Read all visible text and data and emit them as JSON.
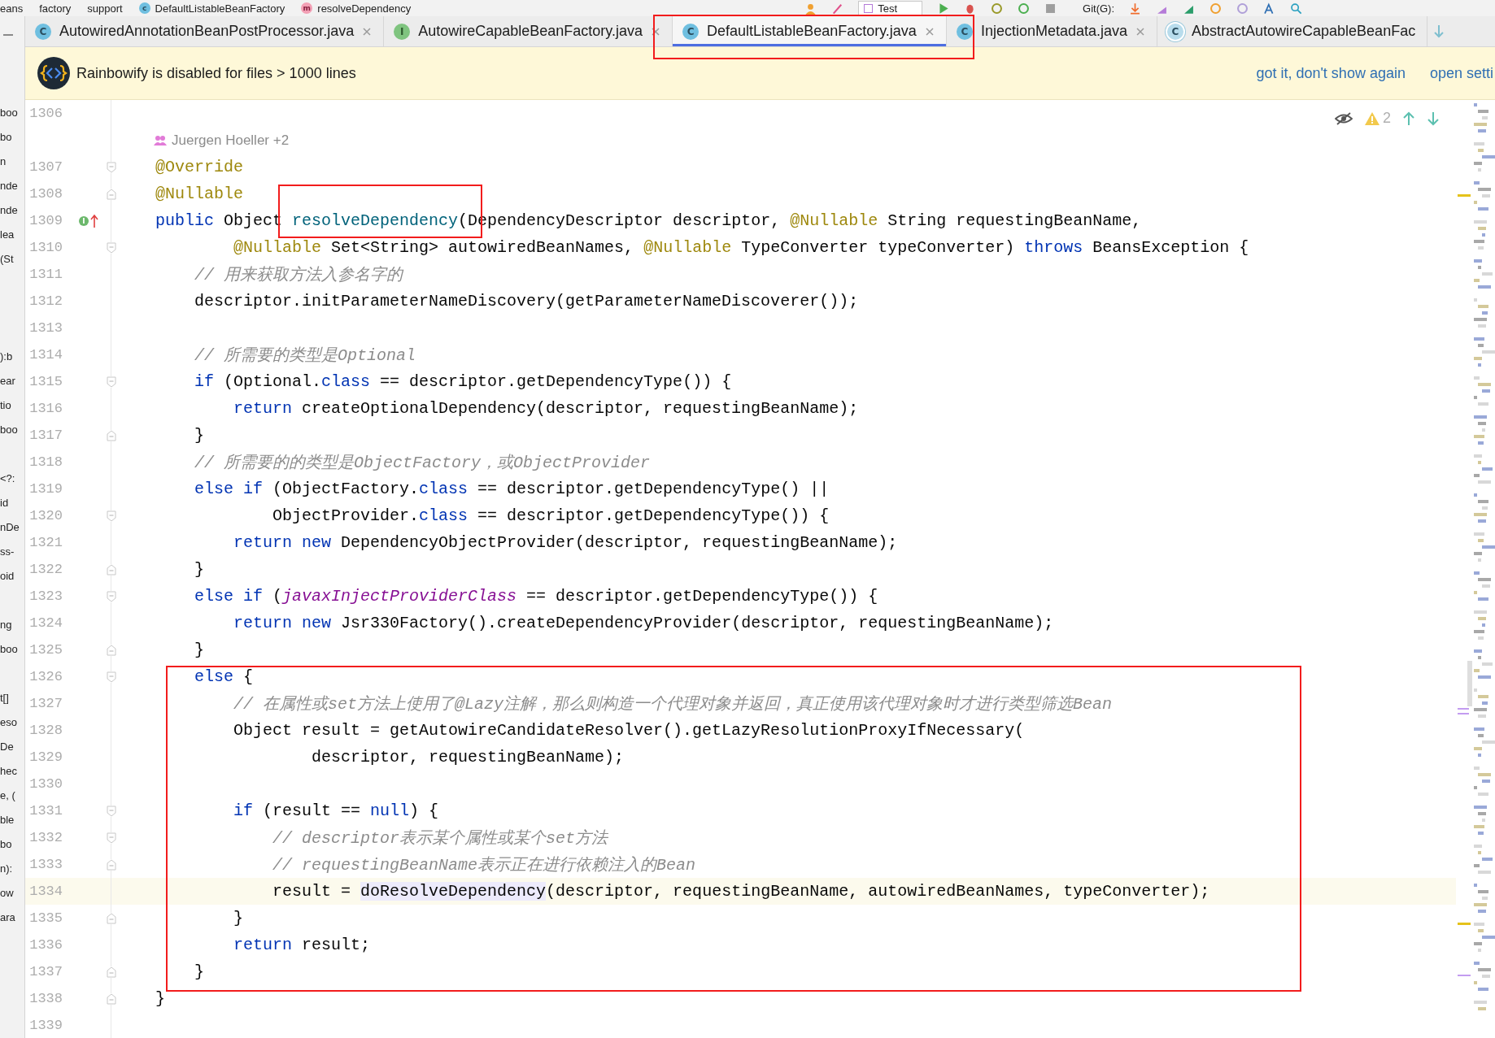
{
  "breadcrumbs": [
    {
      "text": "eans"
    },
    {
      "text": "factory"
    },
    {
      "text": "support"
    },
    {
      "text": "DefaultListableBeanFactory",
      "icon_letter": "c",
      "kind": "class"
    },
    {
      "text": "resolveDependency",
      "icon_letter": "m",
      "kind": "method"
    }
  ],
  "toolbar": {
    "run_config": "Test",
    "vcs_label": "Git(G):"
  },
  "tabs": [
    {
      "label": "AutowiredAnnotationBeanPostProcessor.java",
      "icon_letter": "C",
      "kind": "class",
      "selected": false,
      "boxed": false,
      "closable": true
    },
    {
      "label": "AutowireCapableBeanFactory.java",
      "icon_letter": "I",
      "kind": "interface",
      "selected": false,
      "boxed": false,
      "closable": true
    },
    {
      "label": "DefaultListableBeanFactory.java",
      "icon_letter": "C",
      "kind": "class",
      "selected": true,
      "boxed": true,
      "closable": true
    },
    {
      "label": "InjectionMetadata.java",
      "icon_letter": "C",
      "kind": "class",
      "selected": false,
      "boxed": false,
      "closable": true
    },
    {
      "label": "AbstractAutowireCapableBeanFac",
      "icon_letter": "C",
      "kind": "abstract",
      "selected": false,
      "boxed": false,
      "closable": false
    }
  ],
  "notification": {
    "message": "Rainbowify is disabled for files > 1000 lines",
    "actions": [
      "got it, don't show again",
      "open setti"
    ]
  },
  "project_fragments": [
    [
      "boo",
      "bo",
      "n",
      "nde",
      "nde",
      "lea",
      "(St"
    ],
    [
      "):b",
      "ear",
      "tio",
      "boo"
    ],
    [
      "<?:",
      "id",
      "nDe",
      "ss-",
      "oid"
    ],
    [
      "ng",
      "boo"
    ],
    [
      "t[]",
      "eso",
      "De",
      "hec",
      "e, (",
      "ble",
      "bo",
      "n):",
      "ow",
      "ara"
    ]
  ],
  "inspections": {
    "warnings": "2"
  },
  "code_sections": [
    {
      "boxed": false,
      "lines": [
        {
          "kind": "code",
          "number": "1306",
          "fold_start": false,
          "fold_end": false,
          "current": false
        },
        {
          "kind": "inlay",
          "text": "Juergen Hoeller +2"
        },
        {
          "kind": "code",
          "number": "1307",
          "fold_start": true,
          "fold_end": false,
          "current": false,
          "segments": [
            {
              "kind": "ann",
              "t": "@Override"
            }
          ]
        },
        {
          "kind": "code",
          "number": "1308",
          "fold_start": false,
          "fold_end": true,
          "current": false,
          "segments": [
            {
              "kind": "ann",
              "t": "@Nullable"
            }
          ]
        },
        {
          "kind": "code",
          "number": "1309",
          "fold_start": false,
          "fold_end": false,
          "current": false,
          "gutter_mark": "I",
          "segments": [
            {
              "kind": "kw",
              "t": "public"
            },
            {
              "kind": "plain",
              "t": " Object "
            },
            {
              "kind": "decl",
              "t": "resolveDependency",
              "boxed": true
            },
            {
              "kind": "plain",
              "t": "(DependencyDescriptor descriptor, "
            },
            {
              "kind": "ann",
              "t": "@Nullable"
            },
            {
              "kind": "plain",
              "t": " String requestingBeanName,"
            }
          ]
        },
        {
          "kind": "code",
          "number": "1310",
          "fold_start": true,
          "fold_end": false,
          "current": false,
          "segments": [
            {
              "kind": "ann",
              "t": "        @Nullable"
            },
            {
              "kind": "plain",
              "t": " Set<String> autowiredBeanNames, "
            },
            {
              "kind": "ann",
              "t": "@Nullable"
            },
            {
              "kind": "plain",
              "t": " TypeConverter typeConverter) "
            },
            {
              "kind": "kw",
              "t": "throws"
            },
            {
              "kind": "plain",
              "t": " BeansException {"
            }
          ]
        },
        {
          "kind": "code",
          "number": "1311",
          "fold_start": false,
          "fold_end": false,
          "current": false,
          "segments": [
            {
              "kind": "cmt",
              "t": "    // 用来获取方法入参名字的"
            }
          ]
        },
        {
          "kind": "code",
          "number": "1312",
          "fold_start": false,
          "fold_end": false,
          "current": false,
          "segments": [
            {
              "kind": "plain",
              "t": "    descriptor.initParameterNameDiscovery(getParameterNameDiscoverer());"
            }
          ]
        },
        {
          "kind": "code",
          "number": "1313",
          "fold_start": false,
          "fold_end": false,
          "current": false
        },
        {
          "kind": "code",
          "number": "1314",
          "fold_start": false,
          "fold_end": false,
          "current": false,
          "segments": [
            {
              "kind": "cmt",
              "t": "    // 所需要的类型是Optional"
            }
          ]
        },
        {
          "kind": "code",
          "number": "1315",
          "fold_start": true,
          "fold_end": false,
          "current": false,
          "segments": [
            {
              "kind": "kw",
              "t": "    if"
            },
            {
              "kind": "plain",
              "t": " (Optional."
            },
            {
              "kind": "kw",
              "t": "class"
            },
            {
              "kind": "plain",
              "t": " == descriptor.getDependencyType()) {"
            }
          ]
        },
        {
          "kind": "code",
          "number": "1316",
          "fold_start": false,
          "fold_end": false,
          "current": false,
          "segments": [
            {
              "kind": "kw",
              "t": "        return"
            },
            {
              "kind": "plain",
              "t": " createOptionalDependency(descriptor, requestingBeanName);"
            }
          ]
        },
        {
          "kind": "code",
          "number": "1317",
          "fold_start": false,
          "fold_end": true,
          "current": false,
          "segments": [
            {
              "kind": "plain",
              "t": "    }"
            }
          ]
        },
        {
          "kind": "code",
          "number": "1318",
          "fold_start": false,
          "fold_end": false,
          "current": false,
          "segments": [
            {
              "kind": "cmt",
              "t": "    // 所需要的的类型是ObjectFactory，或ObjectProvider"
            }
          ]
        },
        {
          "kind": "code",
          "number": "1319",
          "fold_start": false,
          "fold_end": false,
          "current": false,
          "segments": [
            {
              "kind": "kw",
              "t": "    else if"
            },
            {
              "kind": "plain",
              "t": " (ObjectFactory."
            },
            {
              "kind": "kw",
              "t": "class"
            },
            {
              "kind": "plain",
              "t": " == descriptor.getDependencyType() ||"
            }
          ]
        },
        {
          "kind": "code",
          "number": "1320",
          "fold_start": true,
          "fold_end": false,
          "current": false,
          "segments": [
            {
              "kind": "plain",
              "t": "            ObjectProvider."
            },
            {
              "kind": "kw",
              "t": "class"
            },
            {
              "kind": "plain",
              "t": " == descriptor.getDependencyType()) {"
            }
          ]
        },
        {
          "kind": "code",
          "number": "1321",
          "fold_start": false,
          "fold_end": false,
          "current": false,
          "segments": [
            {
              "kind": "kw",
              "t": "        return new"
            },
            {
              "kind": "plain",
              "t": " DependencyObjectProvider(descriptor, requestingBeanName);"
            }
          ]
        },
        {
          "kind": "code",
          "number": "1322",
          "fold_start": false,
          "fold_end": true,
          "current": false,
          "segments": [
            {
              "kind": "plain",
              "t": "    }"
            }
          ]
        },
        {
          "kind": "code",
          "number": "1323",
          "fold_start": true,
          "fold_end": false,
          "current": false,
          "segments": [
            {
              "kind": "kw",
              "t": "    else if"
            },
            {
              "kind": "plain",
              "t": " ("
            },
            {
              "kind": "field",
              "t": "javaxInjectProviderClass"
            },
            {
              "kind": "plain",
              "t": " == descriptor.getDependencyType()) {"
            }
          ]
        },
        {
          "kind": "code",
          "number": "1324",
          "fold_start": false,
          "fold_end": false,
          "current": false,
          "segments": [
            {
              "kind": "kw",
              "t": "        return new"
            },
            {
              "kind": "plain",
              "t": " Jsr330Factory().createDependencyProvider(descriptor, requestingBeanName);"
            }
          ]
        },
        {
          "kind": "code",
          "number": "1325",
          "fold_start": false,
          "fold_end": true,
          "current": false,
          "segments": [
            {
              "kind": "plain",
              "t": "    }"
            }
          ]
        }
      ]
    },
    {
      "boxed": true,
      "lines": [
        {
          "kind": "code",
          "number": "1326",
          "fold_start": true,
          "fold_end": false,
          "current": false,
          "segments": [
            {
              "kind": "kw",
              "t": "    else"
            },
            {
              "kind": "plain",
              "t": " {"
            }
          ]
        },
        {
          "kind": "code",
          "number": "1327",
          "fold_start": false,
          "fold_end": false,
          "current": false,
          "segments": [
            {
              "kind": "cmt",
              "t": "        // 在属性或set方法上使用了@Lazy注解，那么则构造一个代理对象并返回，真正使用该代理对象时才进行类型筛选Bean"
            }
          ]
        },
        {
          "kind": "code",
          "number": "1328",
          "fold_start": false,
          "fold_end": false,
          "current": false,
          "segments": [
            {
              "kind": "plain",
              "t": "        Object result = getAutowireCandidateResolver().getLazyResolutionProxyIfNecessary("
            }
          ]
        },
        {
          "kind": "code",
          "number": "1329",
          "fold_start": false,
          "fold_end": false,
          "current": false,
          "segments": [
            {
              "kind": "plain",
              "t": "                descriptor, requestingBeanName);"
            }
          ]
        },
        {
          "kind": "code",
          "number": "1330",
          "fold_start": false,
          "fold_end": false,
          "current": false
        },
        {
          "kind": "code",
          "number": "1331",
          "fold_start": true,
          "fold_end": false,
          "current": false,
          "segments": [
            {
              "kind": "kw",
              "t": "        if"
            },
            {
              "kind": "plain",
              "t": " (result == "
            },
            {
              "kind": "kw",
              "t": "null"
            },
            {
              "kind": "plain",
              "t": ") {"
            }
          ]
        },
        {
          "kind": "code",
          "number": "1332",
          "fold_start": true,
          "fold_end": false,
          "current": false,
          "segments": [
            {
              "kind": "cmt",
              "t": "            // descriptor表示某个属性或某个set方法"
            }
          ]
        },
        {
          "kind": "code",
          "number": "1333",
          "fold_start": false,
          "fold_end": true,
          "current": false,
          "segments": [
            {
              "kind": "cmt",
              "t": "            // requestingBeanName表示正在进行依赖注入的Bean"
            }
          ]
        },
        {
          "kind": "code",
          "number": "1334",
          "fold_start": false,
          "fold_end": false,
          "current": true,
          "segments": [
            {
              "kind": "plain",
              "t": "            result = "
            },
            {
              "kind": "usage",
              "t": "doResolveDependency"
            },
            {
              "kind": "plain",
              "t": "(descriptor, requestingBeanName, autowiredBeanNames, typeConverter);"
            }
          ]
        },
        {
          "kind": "code",
          "number": "1335",
          "fold_start": false,
          "fold_end": true,
          "current": false,
          "segments": [
            {
              "kind": "plain",
              "t": "        }"
            }
          ]
        },
        {
          "kind": "code",
          "number": "1336",
          "fold_start": false,
          "fold_end": false,
          "current": false,
          "segments": [
            {
              "kind": "kw",
              "t": "        return"
            },
            {
              "kind": "plain",
              "t": " result;"
            }
          ]
        },
        {
          "kind": "code",
          "number": "1337",
          "fold_start": false,
          "fold_end": true,
          "current": false,
          "segments": [
            {
              "kind": "plain",
              "t": "    }"
            }
          ]
        }
      ]
    },
    {
      "boxed": false,
      "lines": [
        {
          "kind": "code",
          "number": "1338",
          "fold_start": false,
          "fold_end": true,
          "current": false,
          "segments": [
            {
              "kind": "plain",
              "t": "}"
            }
          ]
        },
        {
          "kind": "code",
          "number": "1339",
          "fold_start": false,
          "fold_end": false,
          "current": false
        }
      ]
    }
  ]
}
